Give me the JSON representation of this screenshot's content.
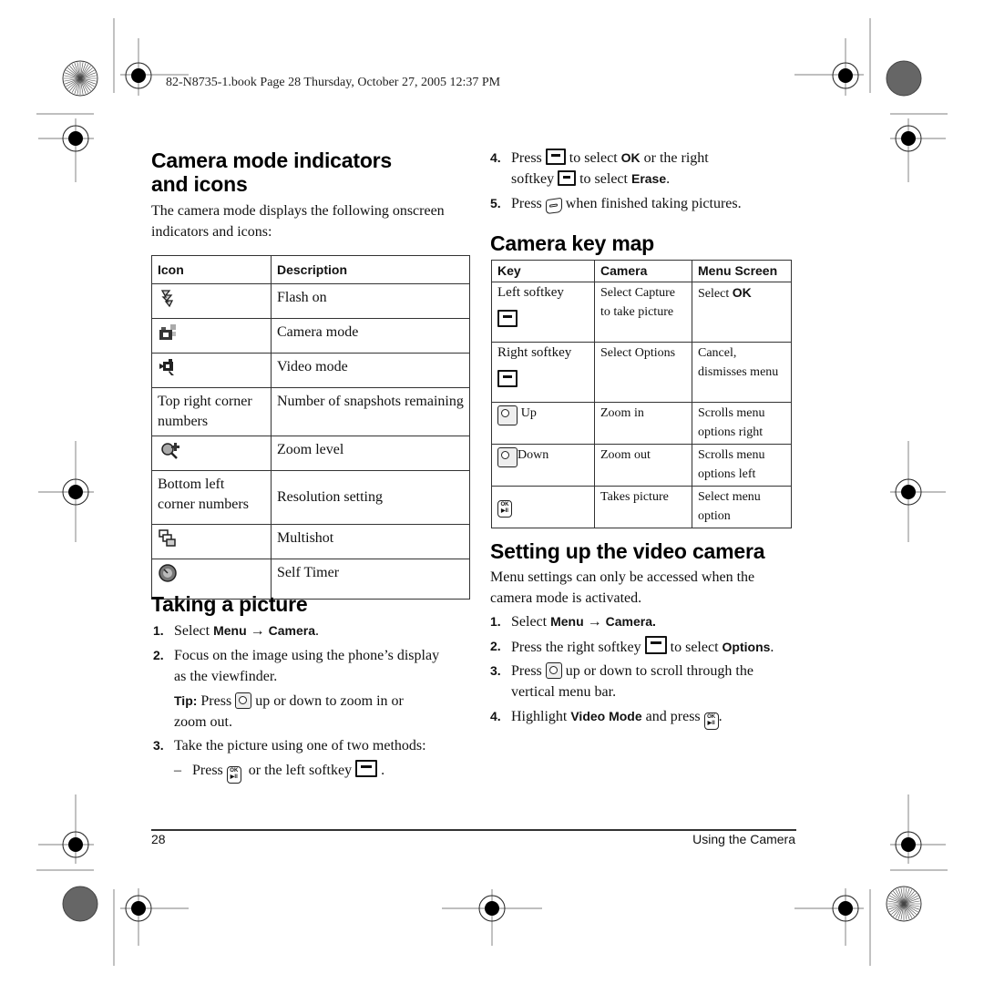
{
  "print_header": "82-N8735-1.book  Page 28  Thursday, October 27, 2005  12:37 PM",
  "left_column": {
    "indicators_section": {
      "title_line1": "Camera mode indicators",
      "title_line2": "and icons",
      "intro": "The camera mode displays the following onscreen indicators and icons:",
      "table": {
        "headers": [
          "Icon",
          "Description"
        ],
        "rows": [
          {
            "icon": "flash-icon",
            "icon_text": "",
            "description": "Flash on"
          },
          {
            "icon": "camera-mode-icon",
            "icon_text": "",
            "description": "Camera mode"
          },
          {
            "icon": "video-mode-icon",
            "icon_text": "",
            "description": "Video mode"
          },
          {
            "icon": "",
            "icon_text": "Top right corner numbers",
            "description": "Number of snapshots remaining"
          },
          {
            "icon": "zoom-level-icon",
            "icon_text": "",
            "description": "Zoom level"
          },
          {
            "icon": "",
            "icon_text": "Bottom left corner numbers",
            "description": "Resolution setting"
          },
          {
            "icon": "multishot-icon",
            "icon_text": "",
            "description": "Multishot"
          },
          {
            "icon": "self-timer-icon",
            "icon_text": "",
            "description": "Self Timer"
          }
        ]
      }
    },
    "taking_picture": {
      "title": "Taking a picture",
      "steps": [
        {
          "num": "1.",
          "pre": "Select ",
          "bold1": "Menu",
          "arrow": " → ",
          "bold2": "Camera",
          "post": "."
        },
        {
          "num": "2.",
          "text_line1": "Focus on the image using the phone’s display",
          "text_line2": "as the viewfinder."
        },
        {
          "num": "3.",
          "text": "Take the picture using one of two methods:"
        }
      ],
      "tip": {
        "label": "Tip:",
        "pre": "Press",
        "post": "up or down to zoom in or",
        "line2": "zoom out."
      },
      "method": {
        "dash": "–",
        "pre": "Press",
        "mid": "or the left softkey",
        "post": "."
      }
    }
  },
  "right_column": {
    "steps_cont": [
      {
        "num": "4.",
        "pre": "Press",
        "mid": "to select",
        "bold1": "OK",
        "post1": "or the right",
        "line2_pre": "softkey",
        "line2_mid": "to select",
        "bold2": "Erase",
        "line2_post": "."
      },
      {
        "num": "5.",
        "pre": "Press",
        "post": "when finished taking pictures."
      }
    ],
    "key_map": {
      "title": "Camera key map",
      "headers": [
        "Key",
        "Camera",
        "Menu Screen"
      ],
      "rows": [
        {
          "key": "Left softkey",
          "key_icon": "left-softkey-icon",
          "camera": "Select Capture to take picture",
          "menu_pre": "Select ",
          "menu_bold": "OK"
        },
        {
          "key": "Right softkey",
          "key_icon": "right-softkey-icon",
          "camera": "Select Options",
          "menu": "Cancel, dismisses menu"
        },
        {
          "key": "Up",
          "key_icon": "nav-key-icon",
          "camera": "Zoom in",
          "menu": "Scrolls menu options right"
        },
        {
          "key": "Down",
          "key_icon": "nav-key-icon",
          "camera": "Zoom out",
          "menu": "Scrolls menu options left"
        },
        {
          "key": "",
          "key_icon": "ok-key-icon",
          "camera": "Takes picture",
          "menu": "Select menu option"
        }
      ]
    },
    "video_setup": {
      "title": "Setting up the video camera",
      "intro_line1": "Menu settings can only be accessed when the",
      "intro_line2": "camera mode is activated.",
      "steps": [
        {
          "num": "1.",
          "pre": "Select ",
          "bold1": "Menu",
          "arrow": " → ",
          "bold2": "Camera."
        },
        {
          "num": "2.",
          "pre": "Press the right softkey",
          "mid": "to select",
          "bold": "Options",
          "post": "."
        },
        {
          "num": "3.",
          "pre": "Press",
          "post": "up or down to scroll through the",
          "line2": "vertical menu bar."
        },
        {
          "num": "4.",
          "pre": "Highlight",
          "bold": "Video Mode",
          "mid": "and press",
          "post": "."
        }
      ]
    }
  },
  "ok_key_glyph_top": "OK",
  "ok_key_glyph_bottom": "▶II",
  "footer": {
    "page_number": "28",
    "section": "Using the Camera"
  }
}
